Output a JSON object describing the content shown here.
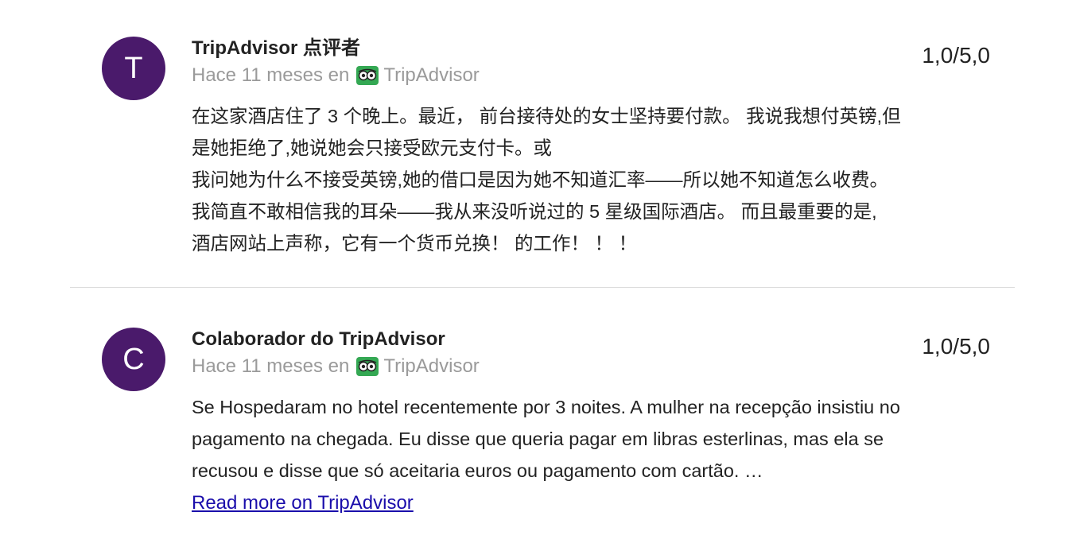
{
  "reviews": [
    {
      "avatar_letter": "T",
      "author": "TripAdvisor 点评者",
      "time_prefix": "Hace 11 meses en",
      "source_icon": "tripadvisor-owl-icon",
      "source": "TripAdvisor",
      "rating": "1,0/5,0",
      "text_lines": [
        "在这家酒店住了 3 个晚上。最近， 前台接待处的女士坚持要付款。 我说我想付英镑,但",
        "是她拒绝了,她说她会只接受欧元支付卡。或",
        "我问她为什么不接受英镑,她的借口是因为她不知道汇率——所以她不知道怎么收费。",
        "我简直不敢相信我的耳朵——我从来没听说过的 5 星级国际酒店。 而且最重要的是,",
        "酒店网站上声称，它有一个货币兑换！ 的工作！ ！ ！"
      ]
    },
    {
      "avatar_letter": "C",
      "author": "Colaborador do TripAdvisor",
      "time_prefix": "Hace 11 meses en",
      "source_icon": "tripadvisor-owl-icon",
      "source": "TripAdvisor",
      "rating": "1,0/5,0",
      "text_lines": [
        "Se Hospedaram no hotel recentemente por 3 noites. A mulher na recepção insistiu no",
        "pagamento na chegada. Eu disse que queria pagar em libras esterlinas, mas ela se",
        "recusou e disse que só aceitaria euros ou pagamento com cartão. …"
      ],
      "read_more": "Read more on TripAdvisor"
    }
  ],
  "colors": {
    "avatar_bg": "#4a1a6b",
    "meta_text": "#9a9a9a",
    "link": "#1a0dab",
    "tripadvisor_green": "#34a853"
  }
}
